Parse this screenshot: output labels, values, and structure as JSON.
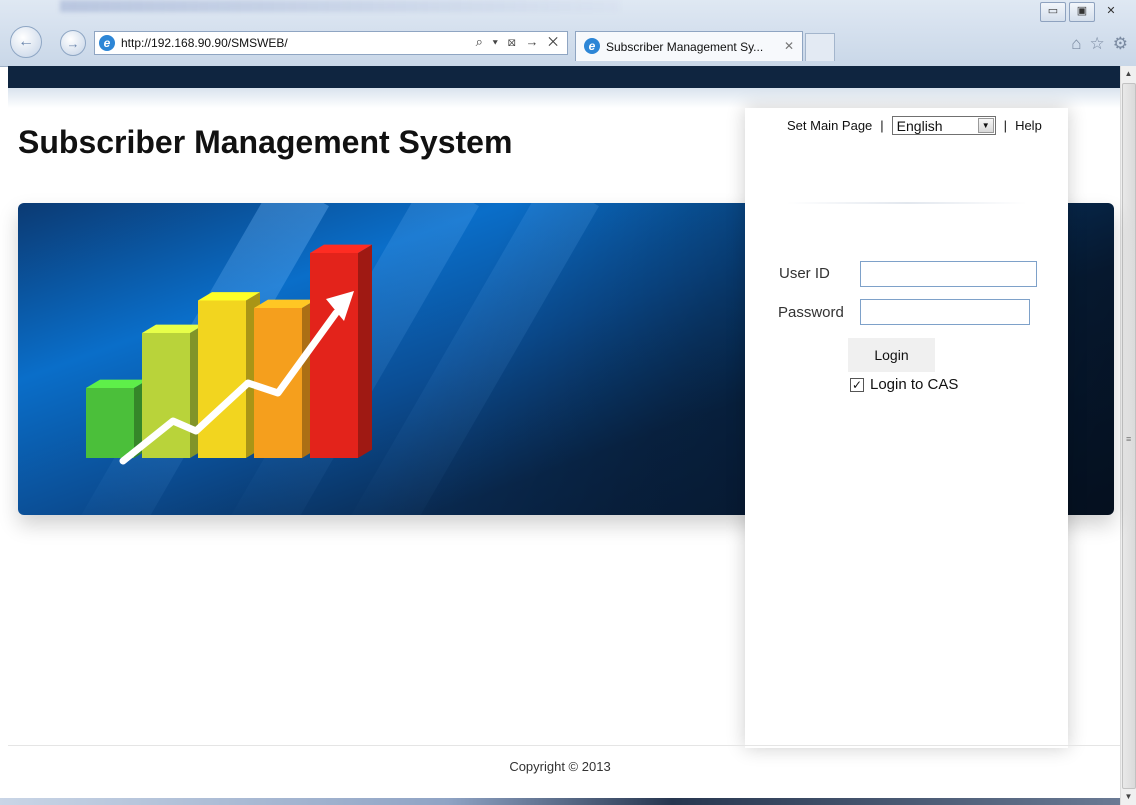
{
  "browser": {
    "url": "http://192.168.90.90/SMSWEB/",
    "tab_title": "Subscriber Management Sy...",
    "addr_tools": "⌕ ▾ ⊠ → ✕",
    "tab_close": "✕",
    "window_controls": {
      "minimize": "▭",
      "maximize": "▣",
      "close": "✕"
    },
    "toolbar_icons": [
      "home-icon",
      "star-icon",
      "gear-icon"
    ]
  },
  "page": {
    "title": "Subscriber Management System",
    "top_links": {
      "set_main_page": "Set Main Page",
      "separator": "|",
      "language": "English",
      "help": "Help"
    },
    "login": {
      "user_id_label": "User ID",
      "password_label": "Password",
      "button_label": "Login",
      "cas_label": "Login to CAS",
      "cas_checked": true,
      "user_id_value": "",
      "password_value": ""
    },
    "footer": {
      "copyright": "Copyright © 2013"
    }
  },
  "colors": {
    "header_band": "#0f2540",
    "banner_blue": "#0a6ec9",
    "input_border": "#7ea1c9"
  },
  "banner_chart": {
    "bar_colors": [
      "#4bbf3a",
      "#b9d33a",
      "#f2d51f",
      "#f59f1d",
      "#e3231b"
    ],
    "bar_levels": [
      0.28,
      0.5,
      0.63,
      0.6,
      0.82
    ]
  }
}
